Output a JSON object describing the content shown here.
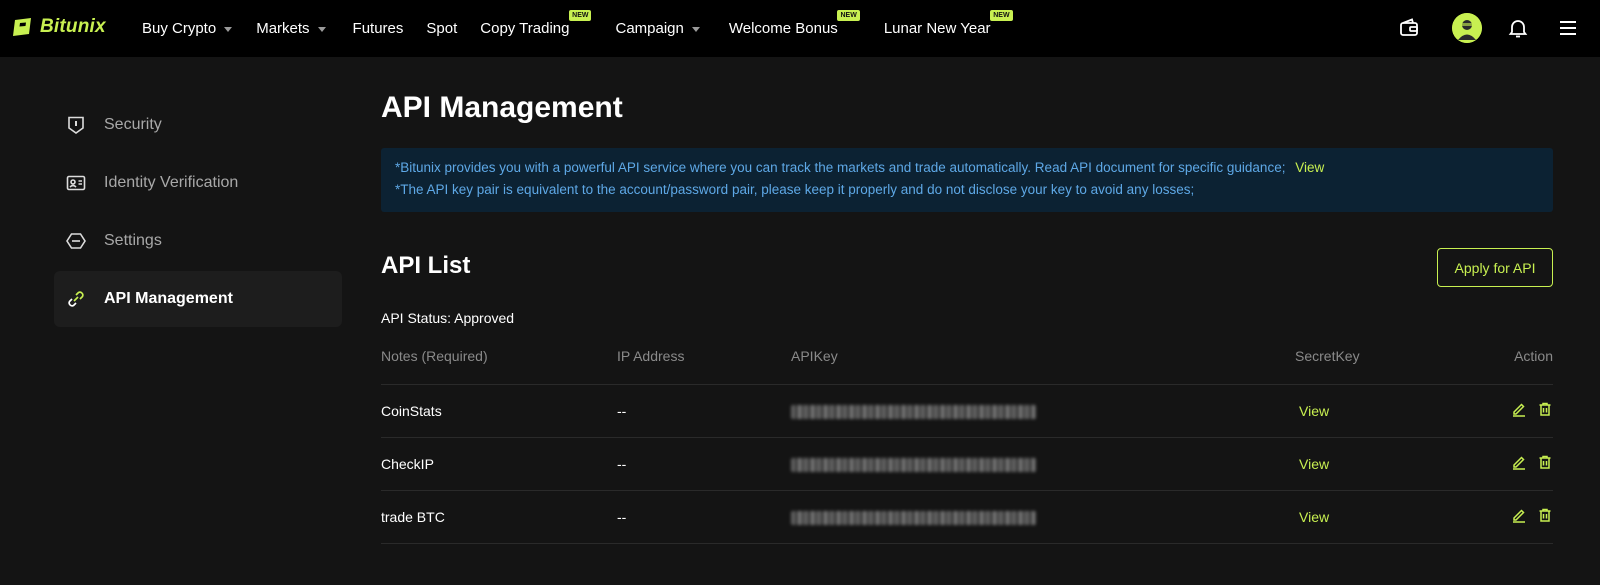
{
  "brand": {
    "name": "Bitunix",
    "accent": "#c8f051"
  },
  "nav": {
    "items": [
      {
        "label": "Buy Crypto",
        "dropdown": true,
        "badge": ""
      },
      {
        "label": "Markets",
        "dropdown": true,
        "badge": ""
      },
      {
        "label": "Futures",
        "dropdown": false,
        "badge": ""
      },
      {
        "label": "Spot",
        "dropdown": false,
        "badge": ""
      },
      {
        "label": "Copy Trading",
        "dropdown": false,
        "badge": "NEW"
      },
      {
        "label": "Campaign",
        "dropdown": true,
        "badge": ""
      },
      {
        "label": "Welcome Bonus",
        "dropdown": false,
        "badge": "NEW"
      },
      {
        "label": "Lunar New Year",
        "dropdown": false,
        "badge": "NEW"
      }
    ],
    "right_icons": [
      "wallet-icon",
      "avatar",
      "bell-icon",
      "menu-icon"
    ]
  },
  "sidebar": {
    "items": [
      {
        "label": "Security",
        "icon": "shield-icon",
        "active": false
      },
      {
        "label": "Identity Verification",
        "icon": "id-card-icon",
        "active": false
      },
      {
        "label": "Settings",
        "icon": "settings-icon",
        "active": false
      },
      {
        "label": "API Management",
        "icon": "api-link-icon",
        "active": true
      }
    ]
  },
  "main": {
    "title": "API Management",
    "notice": {
      "line1": "*Bitunix provides you with a powerful API service where you can track the markets and trade automatically. Read API document for specific guidance;",
      "line1_link": "View",
      "line2": "*The API key pair is equivalent to the account/password pair, please keep it properly and do not disclose your key to avoid any losses;"
    },
    "list_title": "API List",
    "apply_button": "Apply for API",
    "status": "API Status: Approved",
    "table": {
      "headers": [
        "Notes (Required)",
        "IP Address",
        "APIKey",
        "SecretKey",
        "Action"
      ],
      "rows": [
        {
          "notes": "CoinStats",
          "ip": "--",
          "secret": "View"
        },
        {
          "notes": "CheckIP",
          "ip": "--",
          "secret": "View"
        },
        {
          "notes": "trade BTC",
          "ip": "--",
          "secret": "View"
        }
      ]
    }
  }
}
